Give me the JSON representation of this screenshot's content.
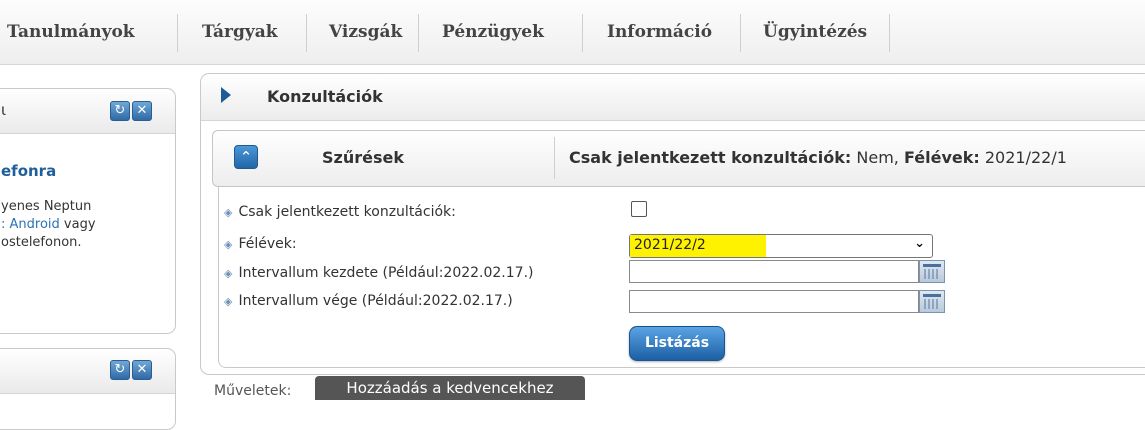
{
  "nav": {
    "items": [
      "Tanulmányok",
      "Tárgyak",
      "Vizsgák",
      "Pénzügyek",
      "Információ",
      "Ügyintézés"
    ]
  },
  "sidebar": {
    "panel1": {
      "title_fragment": "ι",
      "heading": "efonra",
      "line1": "yenes Neptun",
      "line2_link": ": Android",
      "line2_rest": " vagy",
      "line3": "ostelefonon."
    },
    "icons": {
      "refresh": "↻",
      "close": "✕"
    }
  },
  "main": {
    "title": "Konzultációk"
  },
  "filter": {
    "label": "Szűrések",
    "summary_key1": "Csak jelentkezett konzultációk:",
    "summary_val1": " Nem, ",
    "summary_key2": "Félévek:",
    "summary_val2": " 2021/22/1",
    "collapse_icon": "⌃"
  },
  "form": {
    "rows": [
      "Csak jelentkezett konzultációk:",
      "Félévek:",
      "Intervallum kezdete (Például:2022.02.17.)",
      "Intervallum vége (Például:2022.02.17.)"
    ],
    "only_registered_checked": false,
    "semester_selected": "2021/22/2",
    "start_date_value": "",
    "end_date_value": "",
    "list_button": "Listázás"
  },
  "operations": {
    "label": "Műveletek:",
    "favorite_button": "Hozzáadás a kedvencekhez"
  },
  "colors": {
    "accent": "#1f66a8",
    "highlight": "#fff200",
    "heading_blue": "#1e5e9a"
  }
}
